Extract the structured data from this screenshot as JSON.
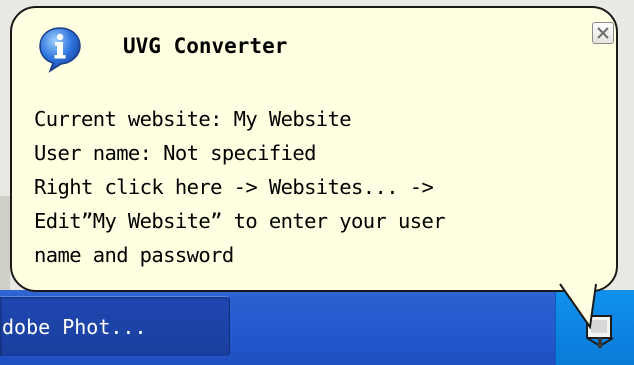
{
  "balloon": {
    "title": "UVG Converter",
    "lines": [
      "Current website: My Website",
      "User name: Not specified",
      "Right click here -> Websites... ->",
      "Edit”My Website” to enter your user",
      "name and password"
    ],
    "icon": "info-icon",
    "close_icon": "close-icon"
  },
  "taskbar": {
    "task_button_label": "dobe Phot..."
  },
  "tray": {
    "icon": "uvg-converter-tray-icon"
  },
  "colors": {
    "balloon_bg": "#ffffe1",
    "taskbar_blue": "#245bd0",
    "tray_blue": "#0f8de9",
    "info_blue": "#2a6bd6"
  }
}
